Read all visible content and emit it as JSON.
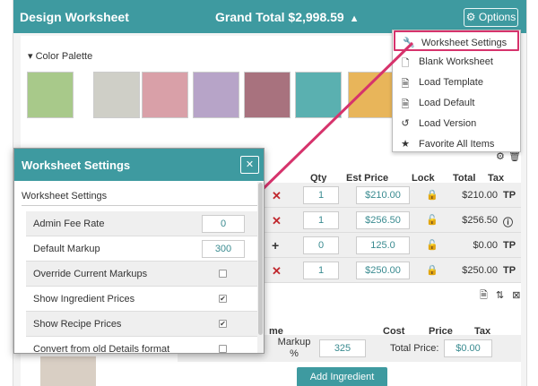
{
  "header": {
    "title": "Design Worksheet",
    "grand_total_label": "Grand Total",
    "grand_total_value": "$2,998.59",
    "warning_glyph": "▲",
    "options_label": "Options"
  },
  "palette": {
    "title": "Color Palette",
    "swatches": [
      "#a8c98a",
      "#cfcfc7",
      "#d9a0a8",
      "#b7a4c8",
      "#a8727e",
      "#5ab0b0",
      "#e8b55a"
    ]
  },
  "table": {
    "columns": [
      "Qty",
      "Est Price",
      "Lock",
      "Total",
      "Tax"
    ],
    "rows": [
      {
        "action": "✕",
        "qty": "1",
        "est": "$210.00",
        "lock": "locked",
        "total": "$210.00",
        "tax": "TP"
      },
      {
        "action": "✕",
        "qty": "1",
        "est": "$256.50",
        "lock": "unlocked",
        "total": "$256.50",
        "tax": "ⓘ"
      },
      {
        "action": "+",
        "qty": "0",
        "est": "125.0",
        "lock": "unlocked",
        "total": "$0.00",
        "tax": "TP"
      },
      {
        "action": "✕",
        "qty": "1",
        "est": "$250.00",
        "lock": "locked",
        "total": "$250.00",
        "tax": "TP"
      }
    ]
  },
  "recipe": {
    "columns": [
      "me",
      "Cost",
      "Price",
      "Tax"
    ],
    "markup_label": "Markup %",
    "markup_value": "325",
    "total_price_label": "Total Price:",
    "total_price_value": "$0.00"
  },
  "add_ingredient_label": "Add Ingredient",
  "options_menu": {
    "items": [
      {
        "icon": "wrench-icon",
        "glyph": "🔧",
        "label": "Worksheet Settings"
      },
      {
        "icon": "blank-document-icon",
        "glyph": "🗋",
        "label": "Blank Worksheet"
      },
      {
        "icon": "template-document-icon",
        "glyph": "🗎",
        "label": "Load Template"
      },
      {
        "icon": "default-document-icon",
        "glyph": "🗎",
        "label": "Load Default"
      },
      {
        "icon": "history-icon",
        "glyph": "↺",
        "label": "Load Version"
      },
      {
        "icon": "star-icon",
        "glyph": "★",
        "label": "Favorite All Items"
      }
    ]
  },
  "modal": {
    "title": "Worksheet Settings",
    "close_glyph": "✕",
    "section_title": "Worksheet Settings",
    "settings": [
      {
        "label": "Admin Fee Rate",
        "value": "0",
        "type": "number"
      },
      {
        "label": "Default Markup",
        "value": "300",
        "type": "number"
      },
      {
        "label": "Override Current Markups",
        "checked": false,
        "type": "checkbox"
      },
      {
        "label": "Show Ingredient Prices",
        "checked": true,
        "type": "checkbox"
      },
      {
        "label": "Show Recipe Prices",
        "checked": true,
        "type": "checkbox"
      },
      {
        "label": "Convert from old Details format",
        "checked": false,
        "type": "checkbox"
      }
    ]
  },
  "colors": {
    "accent": "#3e9aa0",
    "highlight": "#d6336c",
    "danger": "#c0282e"
  }
}
